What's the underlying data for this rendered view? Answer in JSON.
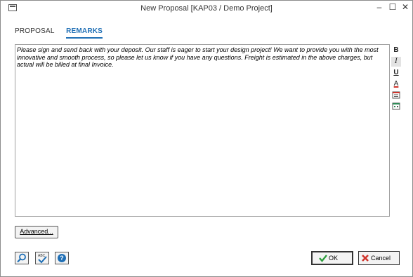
{
  "window": {
    "title": "New Proposal [KAP03 / Demo Project]",
    "minimize_glyph": "–",
    "maximize_glyph": "☐",
    "close_glyph": "✕"
  },
  "tabs": [
    {
      "label": "PROPOSAL",
      "active": false
    },
    {
      "label": "REMARKS",
      "active": true
    }
  ],
  "remarks": {
    "text": "Please sign and send back with your deposit.  Our staff is eager to start your design project! We want to provide you with the most innovative and smooth process, so please let us know if you have any questions.  Freight is estimated in the above charges, but actual will be billed at final Invoice."
  },
  "format_toolbar": {
    "bold": "B",
    "italic": "I",
    "underline": "U",
    "font_color": "A",
    "accent_color": "#d0342c",
    "icon_color": "#2e8b57"
  },
  "buttons": {
    "advanced": "Advanced...",
    "ok": "OK",
    "cancel": "Cancel",
    "ok_icon_color": "#2e9e3e",
    "cancel_icon_color": "#d0342c",
    "help_icon_color": "#1f6fb5"
  }
}
